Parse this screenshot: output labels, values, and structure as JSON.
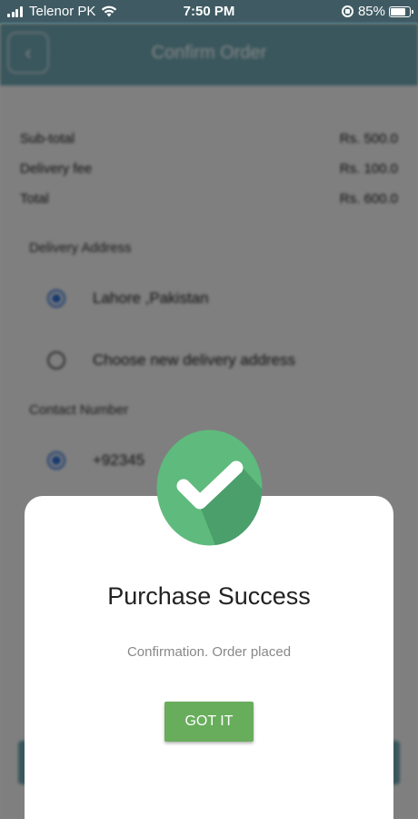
{
  "status_bar": {
    "carrier": "Telenor PK",
    "time": "7:50 PM",
    "battery_percent_label": "85%",
    "battery_level": 0.85
  },
  "header": {
    "title": "Confirm Order",
    "back_icon": "chevron-left-icon"
  },
  "summary": {
    "rows": [
      {
        "label": "Sub-total",
        "value": "Rs. 500.0"
      },
      {
        "label": "Delivery fee",
        "value": "Rs. 100.0"
      },
      {
        "label": "Total",
        "value": "Rs. 600.0"
      }
    ]
  },
  "delivery": {
    "section_label": "Delivery Address",
    "options": [
      {
        "label": "Lahore ,Pakistan",
        "selected": true
      },
      {
        "label": "Choose new delivery address",
        "selected": false
      }
    ]
  },
  "contact": {
    "section_label": "Contact Number",
    "options": [
      {
        "label": "+92345",
        "selected": true
      }
    ]
  },
  "dialog": {
    "title": "Purchase Success",
    "message": "Confirmation. Order placed",
    "button_label": "GOT IT",
    "icon": "check-icon",
    "badge_color": "#5fba7d",
    "badge_shadow_color": "#4a9f6b",
    "button_color": "#68ad5c"
  }
}
